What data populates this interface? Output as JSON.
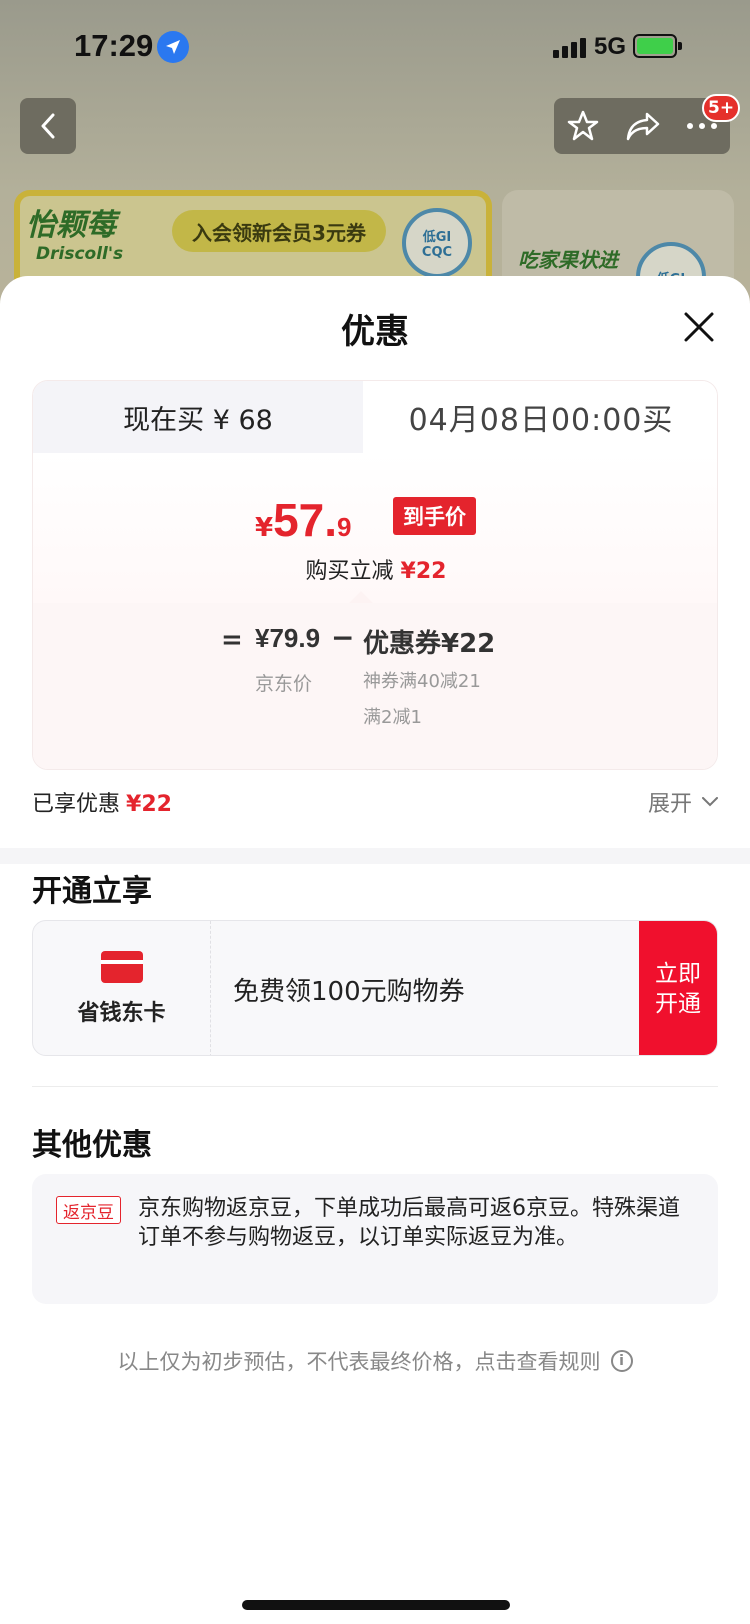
{
  "status": {
    "time": "17:29",
    "network": "5G"
  },
  "nav": {
    "notif_count": "5+"
  },
  "banner": {
    "brand_cn": "怡颗莓",
    "brand_en": "Driscoll's",
    "promo": "入会领新会员3元券",
    "cert_top": "低GI",
    "cert_bottom": "CQC",
    "right_brand": "吃家果状进",
    "right_cert": "低GI"
  },
  "sheet": {
    "title": "优惠",
    "tabs": {
      "now": "现在买 ¥ 68",
      "later": "04月08日00:00买"
    },
    "final_price": {
      "currency": "¥",
      "integer": "57.",
      "decimal": "9",
      "tag": "到手价"
    },
    "instant_off": {
      "label": "购买立减",
      "amount": "¥22"
    },
    "breakdown": {
      "equals": "=",
      "jd_price": "¥79.9",
      "jd_price_label": "京东价",
      "minus": "−",
      "coupon": "优惠券¥22",
      "coupon_detail_1": "神券满40减21",
      "coupon_detail_2": "满2减1"
    },
    "enjoyed": {
      "label": "已享优惠",
      "amount": "¥22",
      "expand": "展开"
    },
    "membership": {
      "section_title": "开通立享",
      "card_name": "省钱东卡",
      "description": "免费领100元购物券",
      "cta": "立即开通"
    },
    "other": {
      "section_title": "其他优惠",
      "tag": "返京豆",
      "text": "京东购物返京豆，下单成功后最高可返6京豆。特殊渠道订单不参与购物返豆，以订单实际返豆为准。"
    },
    "footnote": "以上仅为初步预估，不代表最终价格，点击查看规则"
  },
  "colors": {
    "accent_red": "#e4242d",
    "cta_red": "#f0102d",
    "location_blue": "#2a78f0",
    "battery_green": "#3fcf4a"
  },
  "icons": [
    "location-arrow-icon",
    "signal-icon",
    "battery-icon",
    "back-arrow-icon",
    "star-icon",
    "share-icon",
    "more-icon",
    "close-icon",
    "chevron-down-icon",
    "card-icon",
    "info-icon"
  ]
}
